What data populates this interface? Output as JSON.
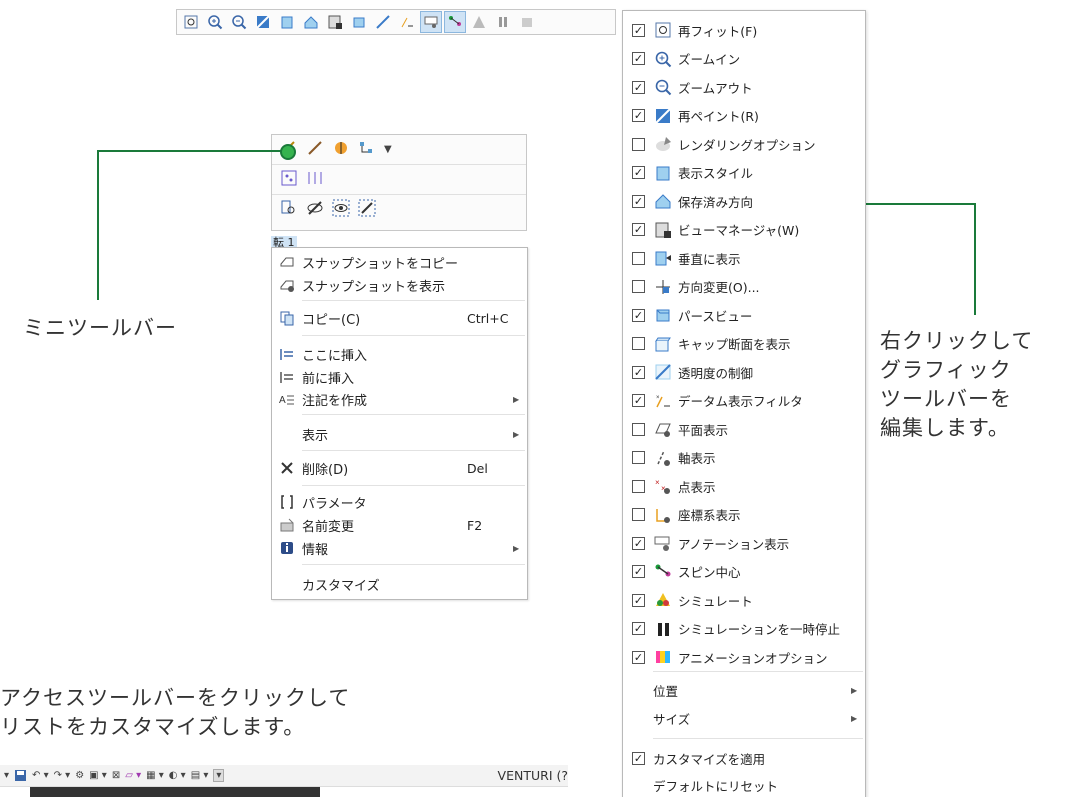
{
  "graphics_toolbar": {
    "icons": [
      "refit-icon",
      "zoom-in-icon",
      "zoom-out-icon",
      "repaint-icon",
      "display-style-icon",
      "saved-orientation-icon",
      "view-manager-icon",
      "perspective-icon",
      "transparency-icon",
      "datum-filter-icon",
      "annotation-display-icon",
      "spin-center-icon",
      "simulate-icon",
      "pause-icon",
      "animation-icon"
    ]
  },
  "mini_toolbar": {
    "label": "ミニツールバー"
  },
  "tree_hint": {
    "label": "転 1"
  },
  "context_menu": {
    "items": [
      {
        "label": "スナップショットをコピー",
        "shortcut": "",
        "submenu": false
      },
      {
        "label": "スナップショットを表示",
        "shortcut": "",
        "submenu": false
      },
      {
        "label": "コピー(C)",
        "shortcut": "Ctrl+C",
        "submenu": false
      },
      {
        "label": "ここに挿入",
        "shortcut": "",
        "submenu": false
      },
      {
        "label": "前に挿入",
        "shortcut": "",
        "submenu": false
      },
      {
        "label": "注記を作成",
        "shortcut": "",
        "submenu": true
      },
      {
        "label": "表示",
        "shortcut": "",
        "submenu": true
      },
      {
        "label": "削除(D)",
        "shortcut": "Del",
        "submenu": false
      },
      {
        "label": "パラメータ",
        "shortcut": "",
        "submenu": false
      },
      {
        "label": "名前変更",
        "shortcut": "F2",
        "submenu": false
      },
      {
        "label": "情報",
        "shortcut": "",
        "submenu": true
      },
      {
        "label": "カスタマイズ",
        "shortcut": "",
        "submenu": false
      }
    ]
  },
  "callouts": {
    "right_line1": "右クリックして",
    "right_line2": "グラフィック",
    "right_line3": "ツールバーを",
    "right_line4": "編集します。",
    "bottom_line1": "アクセスツールバーをクリックして",
    "bottom_line2": "リストをカスタマイズします。"
  },
  "customize_menu": {
    "items": [
      {
        "label": "再フィット(F)",
        "checked": true,
        "icon": "refit-icon"
      },
      {
        "label": "ズームイン",
        "checked": true,
        "icon": "zoom-in-icon"
      },
      {
        "label": "ズームアウト",
        "checked": true,
        "icon": "zoom-out-icon"
      },
      {
        "label": "再ペイント(R)",
        "checked": true,
        "icon": "repaint-icon"
      },
      {
        "label": "レンダリングオプション",
        "checked": false,
        "icon": "rendering-icon"
      },
      {
        "label": "表示スタイル",
        "checked": true,
        "icon": "display-style-icon"
      },
      {
        "label": "保存済み方向",
        "checked": true,
        "icon": "saved-orientation-icon"
      },
      {
        "label": "ビューマネージャ(W)",
        "checked": true,
        "icon": "view-manager-icon"
      },
      {
        "label": "垂直に表示",
        "checked": false,
        "icon": "normal-view-icon"
      },
      {
        "label": "方向変更(O)...",
        "checked": false,
        "icon": "reorient-icon"
      },
      {
        "label": "パースビュー",
        "checked": true,
        "icon": "perspective-icon"
      },
      {
        "label": "キャップ断面を表示",
        "checked": false,
        "icon": "cap-section-icon"
      },
      {
        "label": "透明度の制御",
        "checked": true,
        "icon": "transparency-icon"
      },
      {
        "label": "データム表示フィルタ",
        "checked": true,
        "icon": "datum-filter-icon"
      },
      {
        "label": "平面表示",
        "checked": false,
        "icon": "plane-display-icon"
      },
      {
        "label": "軸表示",
        "checked": false,
        "icon": "axis-display-icon"
      },
      {
        "label": "点表示",
        "checked": false,
        "icon": "point-display-icon"
      },
      {
        "label": "座標系表示",
        "checked": false,
        "icon": "csys-display-icon"
      },
      {
        "label": "アノテーション表示",
        "checked": true,
        "icon": "annotation-display-icon"
      },
      {
        "label": "スピン中心",
        "checked": true,
        "icon": "spin-center-icon"
      },
      {
        "label": "シミュレート",
        "checked": true,
        "icon": "simulate-icon"
      },
      {
        "label": "シミュレーションを一時停止",
        "checked": true,
        "icon": "pause-icon"
      },
      {
        "label": "アニメーションオプション",
        "checked": true,
        "icon": "animation-icon"
      }
    ],
    "position_label": "位置",
    "size_label": "サイズ",
    "apply_label": "カスタマイズを適用",
    "apply_checked": true,
    "reset_label": "デフォルトにリセット"
  },
  "qat": {
    "title": "VENTURI (?"
  }
}
